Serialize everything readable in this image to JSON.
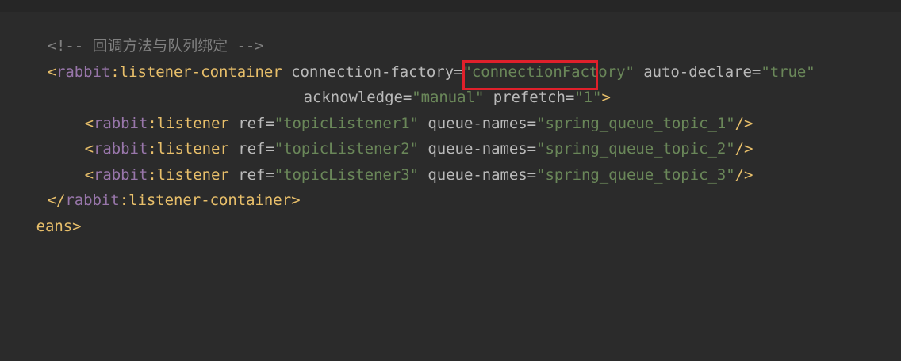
{
  "code": {
    "comment_line": "<!-- 回调方法与队列绑定 -->",
    "container_open": {
      "lt": "<",
      "ns": "rabbit",
      "colon_tag": ":listener-container",
      "attr1_name": " connection-factory",
      "attr1_eq": "=",
      "attr1_val": "\"connectionFactory\"",
      "attr2_name": " auto-declare",
      "attr2_eq": "=",
      "attr2_val": "\"true\""
    },
    "container_cont": {
      "attr3_name": "acknowledge",
      "attr3_eq": "=",
      "attr3_val": "\"manual\"",
      "attr4_name": " prefetch",
      "attr4_eq": "=",
      "attr4_val": "\"1\"",
      "gt": ">"
    },
    "listeners": [
      {
        "lt": "<",
        "ns": "rabbit",
        "tag": ":listener",
        "ref_name": " ref",
        "eq": "=",
        "ref_val": "\"topicListener1\"",
        "q_name": " queue-names",
        "q_eq": "=",
        "q_val": "\"spring_queue_topic_1\"",
        "close": "/>"
      },
      {
        "lt": "<",
        "ns": "rabbit",
        "tag": ":listener",
        "ref_name": " ref",
        "eq": "=",
        "ref_val": "\"topicListener2\"",
        "q_name": " queue-names",
        "q_eq": "=",
        "q_val": "\"spring_queue_topic_2\"",
        "close": "/>"
      },
      {
        "lt": "<",
        "ns": "rabbit",
        "tag": ":listener",
        "ref_name": " ref",
        "eq": "=",
        "ref_val": "\"topicListener3\"",
        "q_name": " queue-names",
        "q_eq": "=",
        "q_val": "\"spring_queue_topic_3\"",
        "close": "/>"
      }
    ],
    "container_close": {
      "lt": "</",
      "ns": "rabbit",
      "tag": ":listener-container",
      "gt": ">"
    },
    "beans_close": "eans>"
  },
  "colors": {
    "background": "#2b2b2b",
    "tag": "#e8bf6a",
    "namespace": "#9876aa",
    "attribute": "#bababa",
    "string": "#6a8759",
    "comment": "#808080",
    "highlight_box": "#e0202b"
  }
}
